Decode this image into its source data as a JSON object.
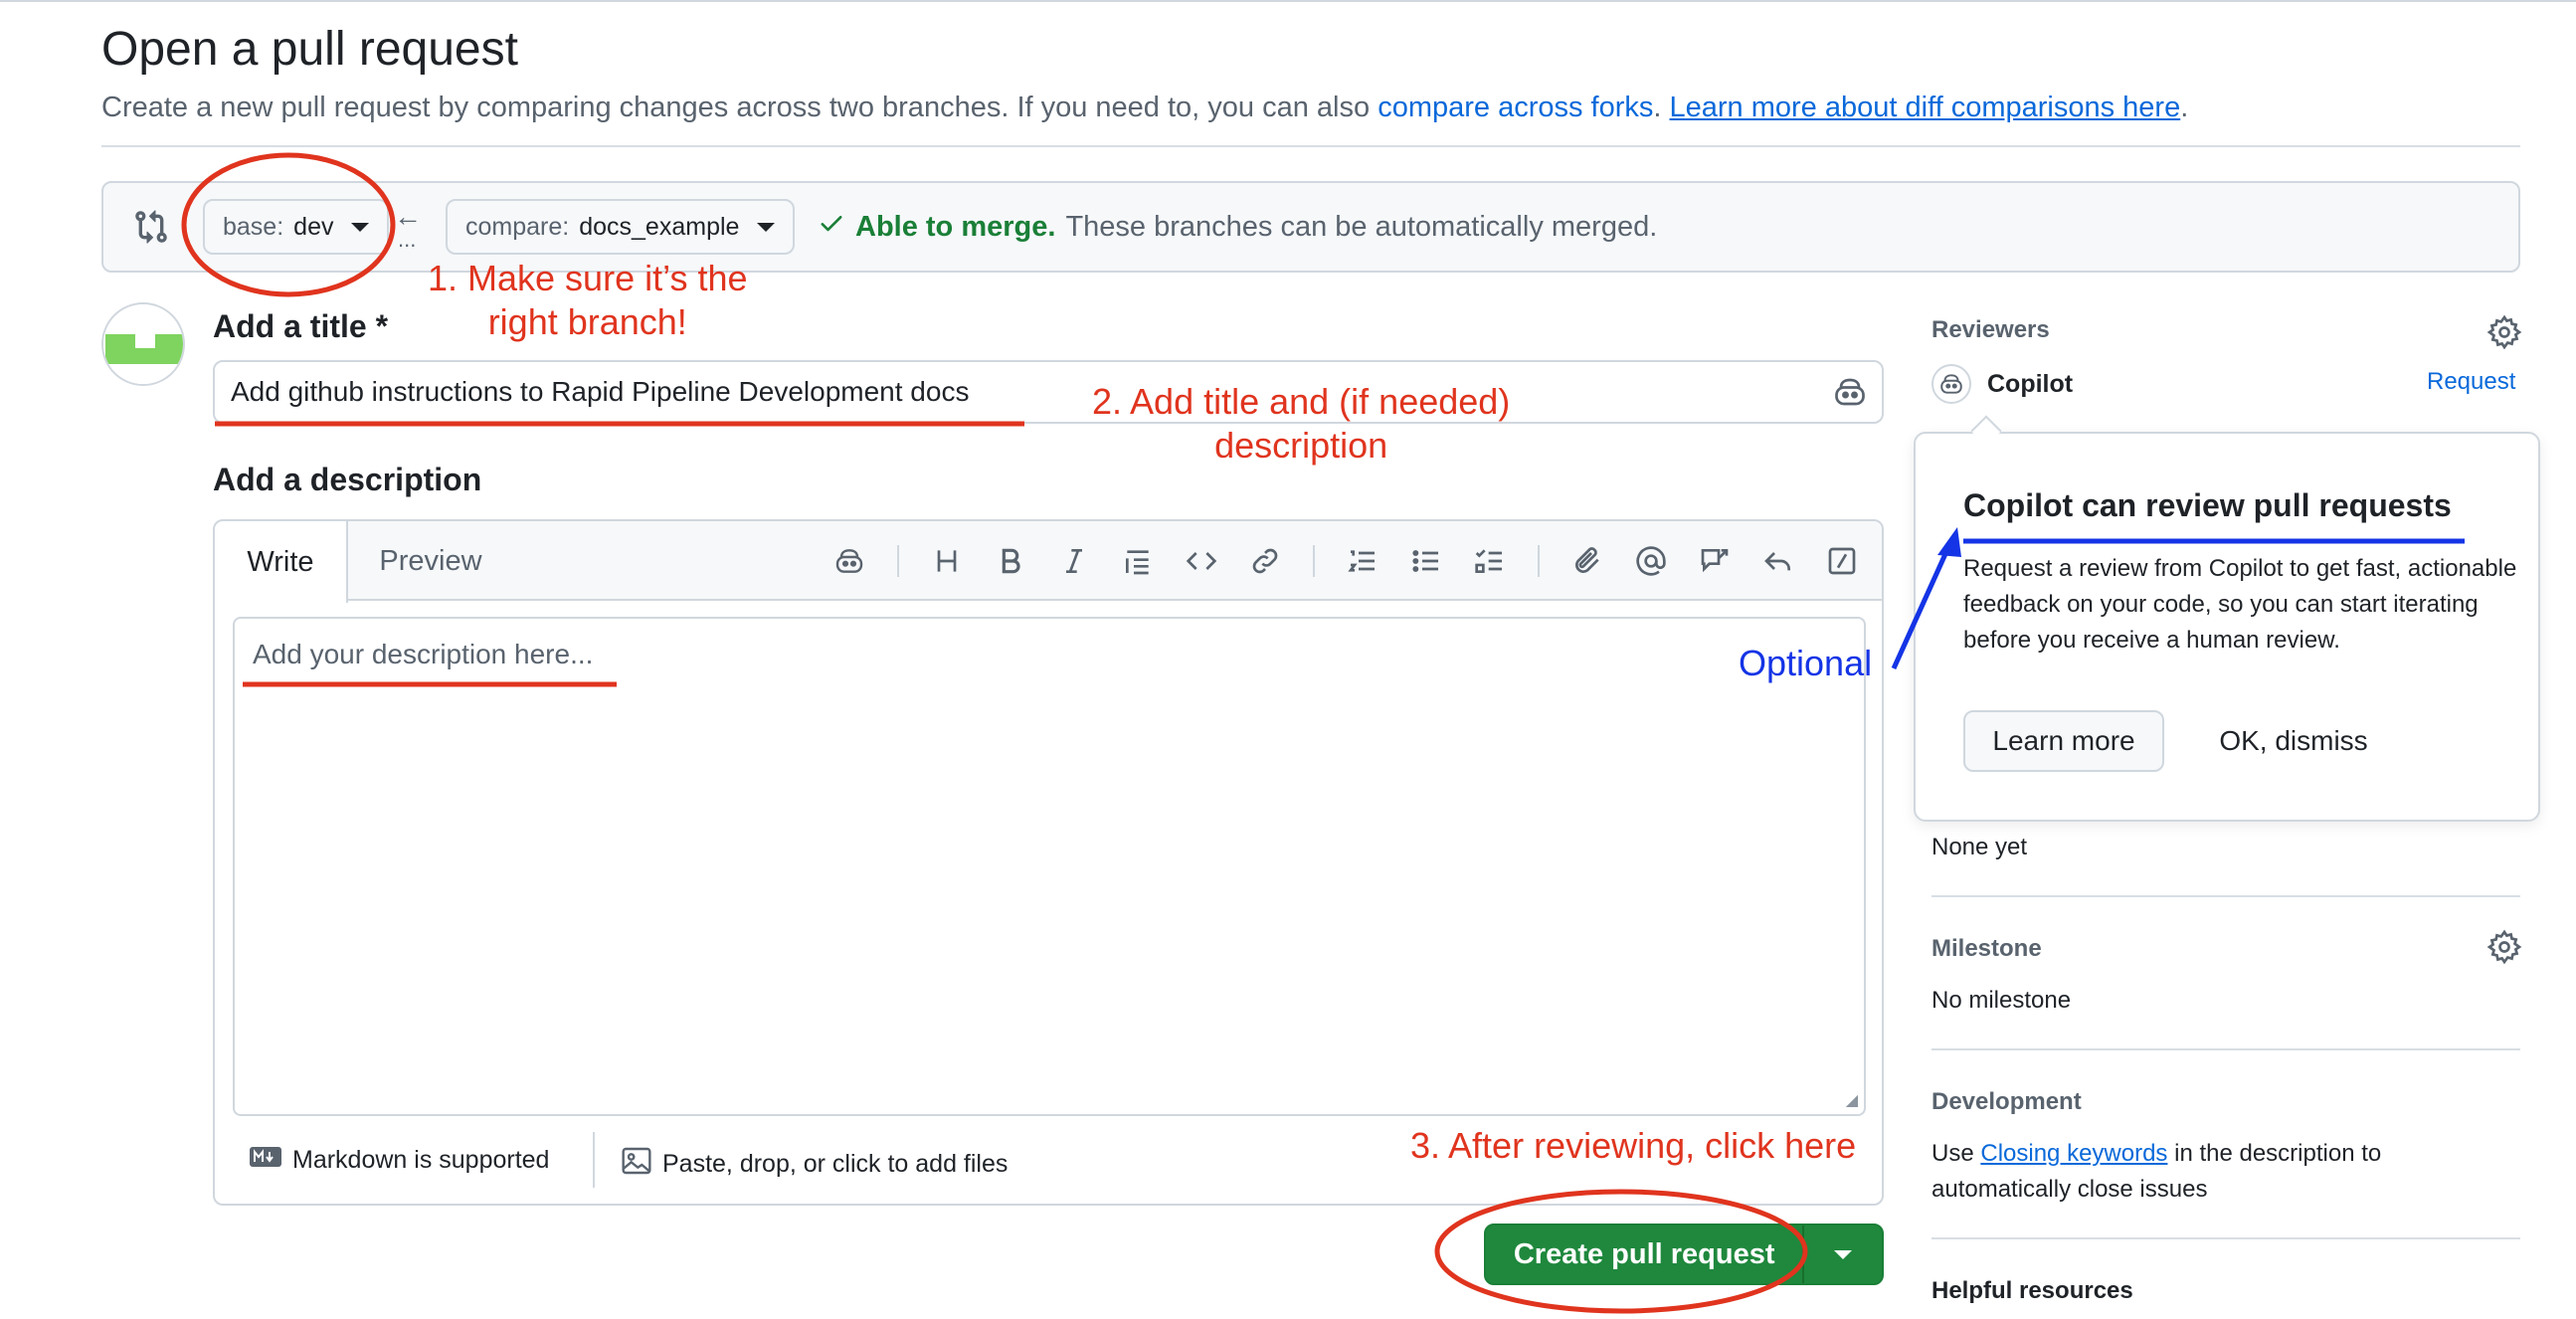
{
  "page": {
    "title": "Open a pull request",
    "subtitle_text": "Create a new pull request by comparing changes across two branches. If you need to, you can also",
    "compare_forks_link": "compare across forks",
    "learn_more_link": "Learn more about diff comparisons here"
  },
  "range": {
    "base_label": "base:",
    "base_value": "dev",
    "compare_label": "compare:",
    "compare_value": "docs_example",
    "swap_dots": "...",
    "merge_status": "Able to merge.",
    "merge_detail": "These branches can be automatically merged."
  },
  "form": {
    "title_label": "Add a title",
    "required_mark": "*",
    "title_value": "Add github instructions to Rapid Pipeline Development docs",
    "description_label": "Add a description",
    "tabs": [
      "Write",
      "Preview"
    ],
    "description_placeholder": "Add your description here...",
    "markdown_note": "Markdown is supported",
    "files_note": "Paste, drop, or click to add files",
    "submit_label": "Create pull request"
  },
  "sidebar": {
    "reviewers_label": "Reviewers",
    "copilot_name": "Copilot",
    "request_label": "Request",
    "reviewers_value": "None yet",
    "milestone_label": "Milestone",
    "milestone_value": "No milestone",
    "development_label": "Development",
    "development_pre": "Use",
    "development_link": "Closing keywords",
    "development_post": "in the description to",
    "development_line2": "automatically close issues",
    "helpful_label": "Helpful resources"
  },
  "popover": {
    "title": "Copilot can review pull requests",
    "body": "Request a review from Copilot to get fast, actionable feedback on your code, so you can start iterating before you receive a human review.",
    "learn_more": "Learn more",
    "dismiss": "OK, dismiss"
  },
  "annotations": {
    "step1_line1": "1. Make sure it’s the",
    "step1_line2": "right branch!",
    "step2_line1": "2. Add title and (if needed)",
    "step2_line2": "description",
    "step3": "3. After reviewing, click here",
    "optional": "Optional",
    "red_color": "#e0341e",
    "blue_color": "#1434e6"
  },
  "colors": {
    "accent_green": "#1f883d",
    "link_blue": "#0969da",
    "merge_green": "#1a7f37"
  }
}
